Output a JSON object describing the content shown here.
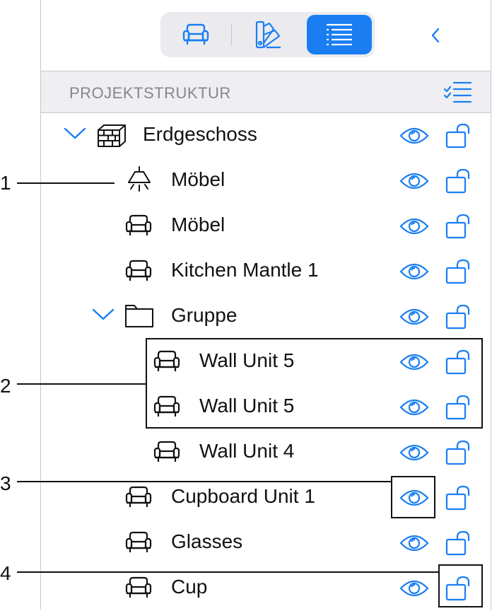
{
  "header": {
    "title": "PROJEKTSTRUKTUR"
  },
  "rows": [
    {
      "label": "Erdgeschoss",
      "icon": "floor-icon"
    },
    {
      "label": "Möbel",
      "icon": "lamp-icon"
    },
    {
      "label": "Möbel",
      "icon": "armchair-icon"
    },
    {
      "label": "Kitchen Mantle 1",
      "icon": "armchair-icon"
    },
    {
      "label": "Gruppe",
      "icon": "folder-icon"
    },
    {
      "label": "Wall Unit 5",
      "icon": "armchair-icon"
    },
    {
      "label": "Wall Unit 5",
      "icon": "armchair-icon"
    },
    {
      "label": "Wall Unit 4",
      "icon": "armchair-icon"
    },
    {
      "label": "Cupboard Unit 1",
      "icon": "armchair-icon"
    },
    {
      "label": "Glasses",
      "icon": "armchair-icon"
    },
    {
      "label": "Cup",
      "icon": "armchair-icon"
    }
  ],
  "callouts": [
    "1",
    "2",
    "3",
    "4"
  ],
  "colors": {
    "accent": "#1a7ef2",
    "header_bg": "#efeff3",
    "text": "#111111"
  }
}
